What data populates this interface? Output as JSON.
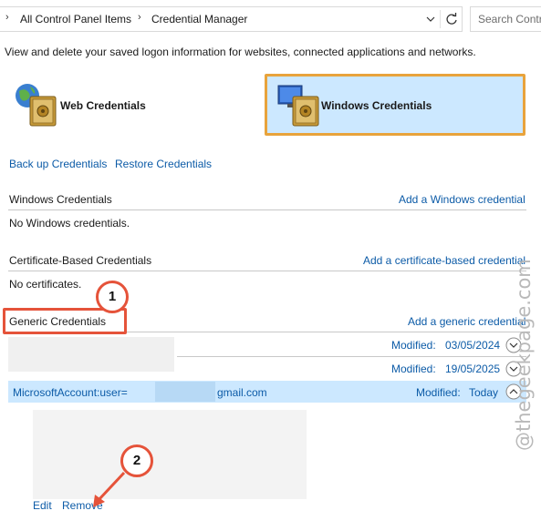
{
  "address_bar": {
    "crumb_1": "All Control Panel Items",
    "crumb_2": "Credential Manager",
    "search_placeholder": "Search Contr"
  },
  "description": "View and delete your saved logon information for websites, connected applications and networks.",
  "types": {
    "web": "Web Credentials",
    "windows": "Windows Credentials"
  },
  "actions": {
    "backup": "Back up Credentials",
    "restore": "Restore Credentials"
  },
  "sections": {
    "windows": {
      "title": "Windows Credentials",
      "add": "Add a Windows credential",
      "empty": "No Windows credentials."
    },
    "certificate": {
      "title": "Certificate-Based Credentials",
      "add": "Add a certificate-based credential",
      "empty": "No certificates."
    },
    "generic": {
      "title": "Generic Credentials",
      "add": "Add a generic credential",
      "rows": [
        {
          "modified_label": "Modified:",
          "modified_value": "03/05/2024"
        },
        {
          "modified_label": "Modified:",
          "modified_value": "19/05/2025"
        },
        {
          "name_prefix": "MicrosoftAccount:user=",
          "name_suffix": "gmail.com",
          "modified_label": "Modified:",
          "modified_value": "Today"
        }
      ],
      "edit": "Edit",
      "remove": "Remove"
    }
  },
  "annotations": {
    "step_1": "1",
    "step_2": "2",
    "accent": "#e5533a"
  },
  "watermark": "@thegeekpage.com",
  "colors": {
    "link": "#0c5ba7",
    "selection": "#cce8ff",
    "highlight_border": "#e8a33c"
  }
}
